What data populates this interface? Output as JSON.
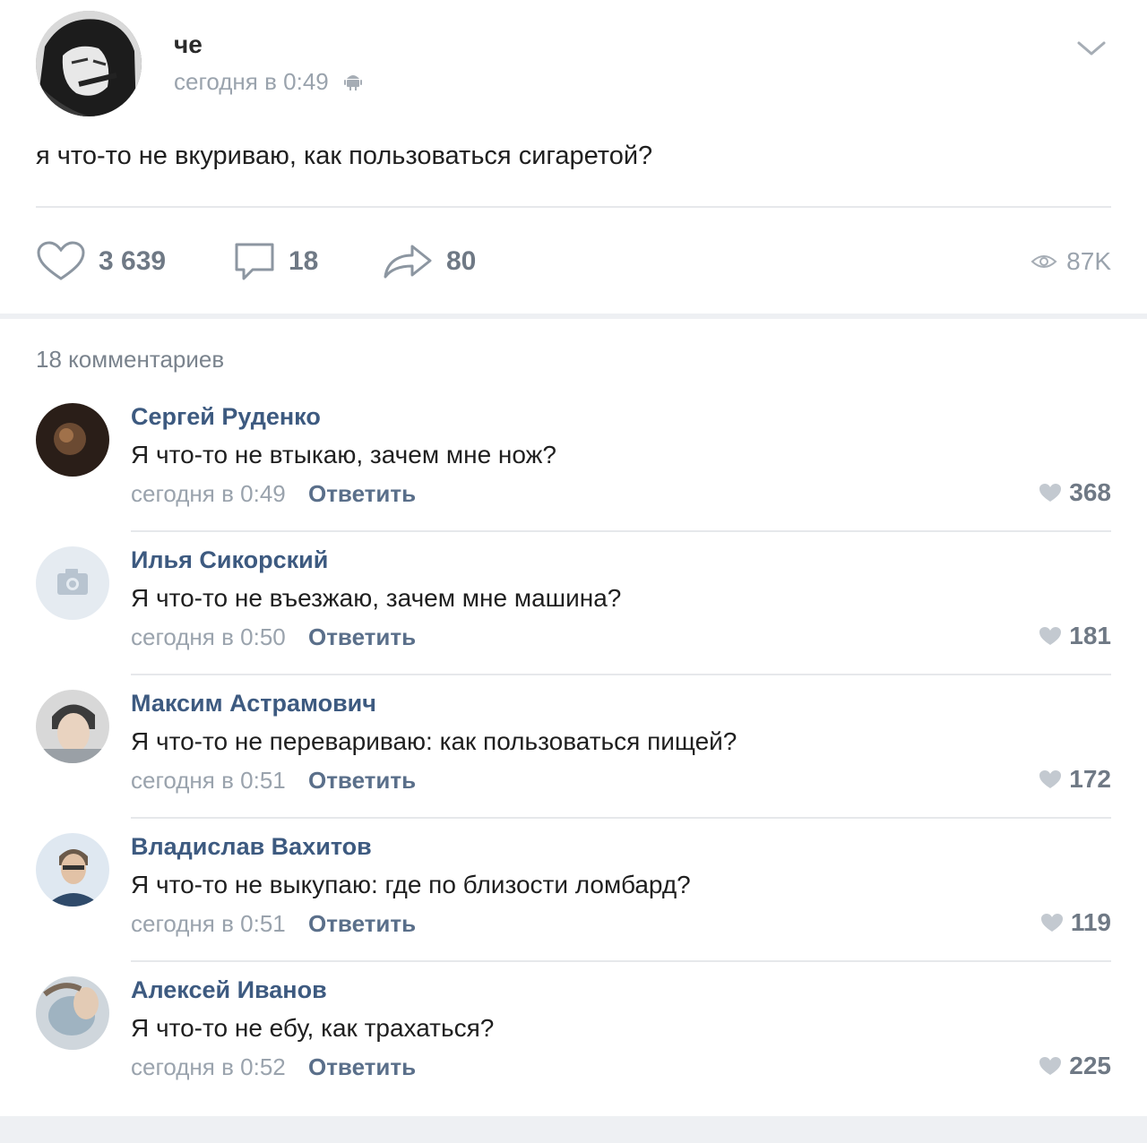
{
  "post": {
    "author": "че",
    "time": "сегодня в 0:49",
    "text": "я что-то не вкуриваю, как пользоваться сигаретой?",
    "likes": "3 639",
    "comments": "18",
    "shares": "80",
    "views": "87K"
  },
  "comments_header": "18 комментариев",
  "reply_label": "Ответить",
  "comments": [
    {
      "name": "Сергей Руденко",
      "text": "Я что-то не втыкаю, зачем мне нож?",
      "time": "сегодня в 0:49",
      "likes": "368"
    },
    {
      "name": "Илья Сикорский",
      "text": "Я что-то не въезжаю, зачем мне машина?",
      "time": "сегодня в 0:50",
      "likes": "181"
    },
    {
      "name": "Максим Астрамович",
      "text": "Я что-то не перевариваю: как пользоваться пищей?",
      "time": "сегодня в 0:51",
      "likes": "172"
    },
    {
      "name": "Владислав Вахитов",
      "text": "Я что-то не выкупаю: где по близости ломбард?",
      "time": "сегодня в 0:51",
      "likes": "119"
    },
    {
      "name": "Алексей Иванов",
      "text": "Я что-то не ебу, как трахаться?",
      "time": "сегодня в 0:52",
      "likes": "225"
    }
  ]
}
